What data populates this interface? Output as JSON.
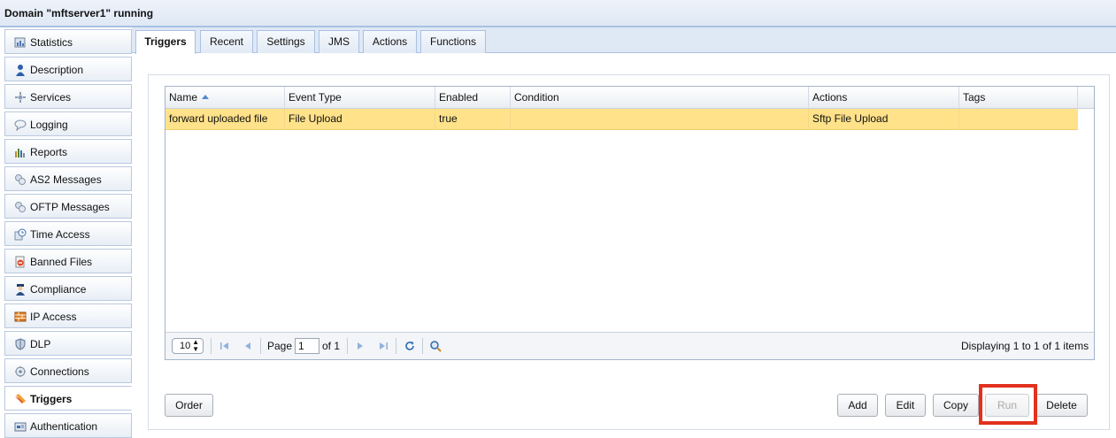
{
  "window": {
    "title": "Domain \"mftserver1\" running"
  },
  "sidebar": {
    "items": [
      {
        "label": "Statistics",
        "icon": "statistics-icon"
      },
      {
        "label": "Description",
        "icon": "person-icon"
      },
      {
        "label": "Services",
        "icon": "services-icon"
      },
      {
        "label": "Logging",
        "icon": "speech-bubble-icon"
      },
      {
        "label": "Reports",
        "icon": "bar-chart-icon"
      },
      {
        "label": "AS2 Messages",
        "icon": "messages-icon"
      },
      {
        "label": "OFTP Messages",
        "icon": "messages-icon"
      },
      {
        "label": "Time Access",
        "icon": "clock-icon"
      },
      {
        "label": "Banned Files",
        "icon": "banned-file-icon"
      },
      {
        "label": "Compliance",
        "icon": "officer-icon"
      },
      {
        "label": "IP Access",
        "icon": "firewall-icon"
      },
      {
        "label": "DLP",
        "icon": "shield-icon"
      },
      {
        "label": "Connections",
        "icon": "connections-icon"
      },
      {
        "label": "Triggers",
        "icon": "trigger-icon",
        "active": true
      },
      {
        "label": "Authentication",
        "icon": "authentication-icon"
      }
    ]
  },
  "tabs": [
    {
      "label": "Triggers",
      "active": true
    },
    {
      "label": "Recent"
    },
    {
      "label": "Settings"
    },
    {
      "label": "JMS"
    },
    {
      "label": "Actions"
    },
    {
      "label": "Functions"
    }
  ],
  "grid": {
    "columns": [
      "Name",
      "Event Type",
      "Enabled",
      "Condition",
      "Actions",
      "Tags"
    ],
    "sort_column": "Name",
    "sort_direction": "ascending",
    "rows": [
      {
        "name": "forward uploaded file",
        "event_type": "File Upload",
        "enabled": "true",
        "condition": "",
        "actions": "Sftp File Upload",
        "tags": ""
      }
    ],
    "pager": {
      "page_size": "10",
      "page_label": "Page",
      "page_value": "1",
      "of_label": "of 1",
      "display_text": "Displaying 1 to 1 of 1 items"
    }
  },
  "buttons": {
    "order": "Order",
    "add": "Add",
    "edit": "Edit",
    "copy": "Copy",
    "run": "Run",
    "delete": "Delete"
  },
  "colors": {
    "selected_row": "#ffe289",
    "highlight_box": "#e2311d",
    "tab_border": "#a9c1e2"
  }
}
